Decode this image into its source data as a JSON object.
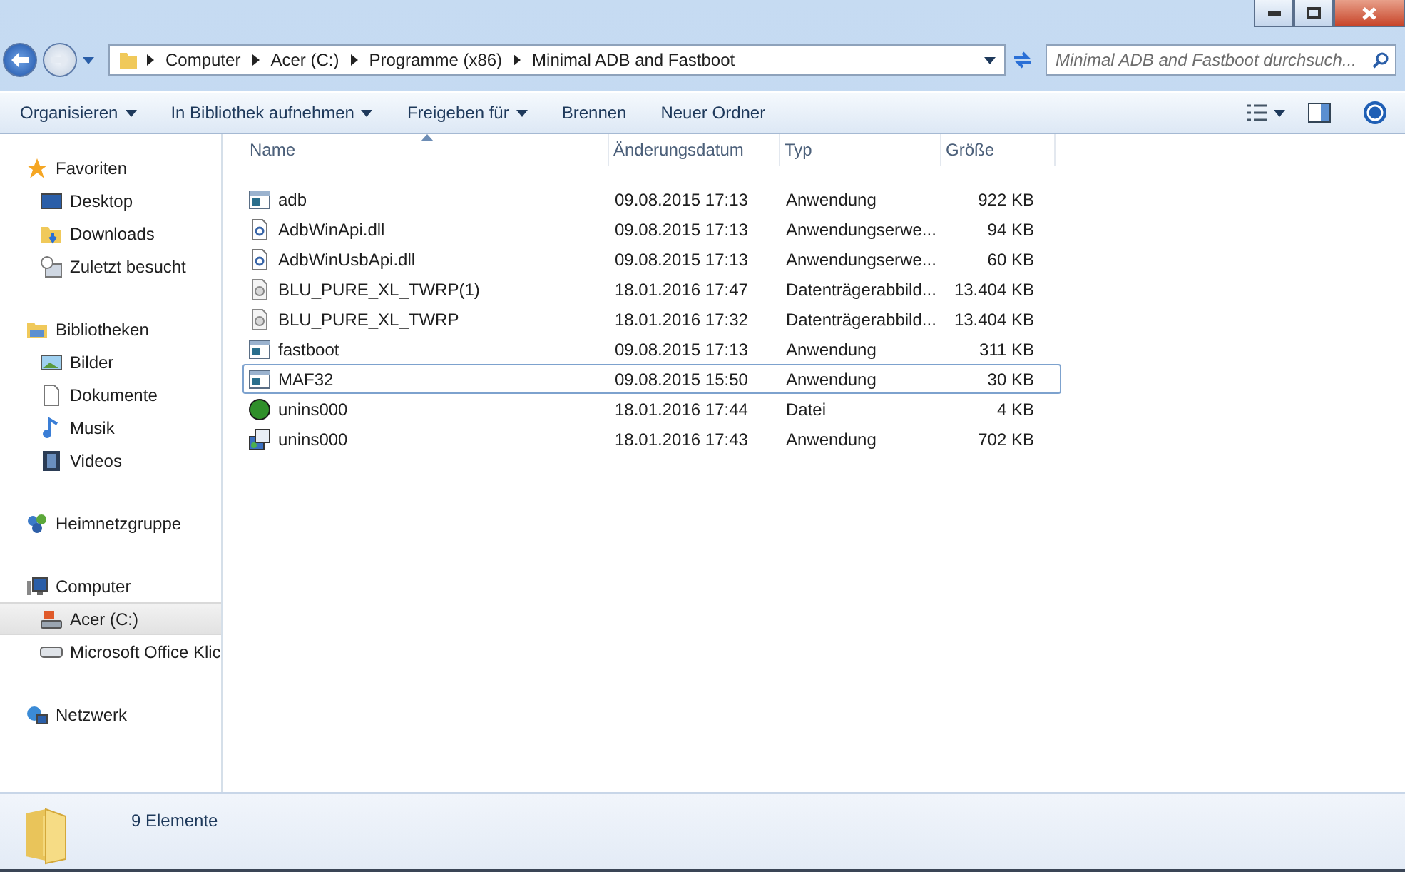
{
  "address": {
    "crumbs": [
      "Computer",
      "Acer (C:)",
      "Programme (x86)",
      "Minimal ADB and Fastboot"
    ]
  },
  "search": {
    "placeholder": "Minimal ADB and Fastboot durchsuch..."
  },
  "toolbar": {
    "items": [
      {
        "label": "Organisieren",
        "dropdown": true
      },
      {
        "label": "In Bibliothek aufnehmen",
        "dropdown": true
      },
      {
        "label": "Freigeben für",
        "dropdown": true
      },
      {
        "label": "Brennen",
        "dropdown": false
      },
      {
        "label": "Neuer Ordner",
        "dropdown": false
      }
    ]
  },
  "sidebar": {
    "groups": [
      {
        "label": "Favoriten",
        "kind": "star",
        "selected": false,
        "children": [
          {
            "label": "Desktop",
            "kind": "desktop",
            "selected": false
          },
          {
            "label": "Downloads",
            "kind": "download",
            "selected": false
          },
          {
            "label": "Zuletzt besucht",
            "kind": "recent",
            "selected": false
          }
        ]
      },
      {
        "label": "Bibliotheken",
        "kind": "library",
        "selected": false,
        "children": [
          {
            "label": "Bilder",
            "kind": "image",
            "selected": false
          },
          {
            "label": "Dokumente",
            "kind": "document",
            "selected": false
          },
          {
            "label": "Musik",
            "kind": "music",
            "selected": false
          },
          {
            "label": "Videos",
            "kind": "video",
            "selected": false
          }
        ]
      },
      {
        "label": "Heimnetzgruppe",
        "kind": "homegroup",
        "selected": false
      },
      {
        "label": "Computer",
        "kind": "computer",
        "selected": false,
        "children": [
          {
            "label": "Acer (C:)",
            "kind": "drive",
            "selected": true
          },
          {
            "label": "Microsoft Office Klic",
            "kind": "disk",
            "selected": false
          }
        ]
      },
      {
        "label": "Netzwerk",
        "kind": "network",
        "selected": false
      }
    ]
  },
  "table": {
    "columns": [
      {
        "label": "Name",
        "sorted": true
      },
      {
        "label": "Änderungsdatum",
        "sorted": false
      },
      {
        "label": "Typ",
        "sorted": false
      },
      {
        "label": "Größe",
        "sorted": false
      }
    ],
    "rows": [
      {
        "name": "adb",
        "date": "09.08.2015 17:13",
        "type": "Anwendung",
        "size": "922 KB",
        "kind": "app",
        "focused": false
      },
      {
        "name": "AdbWinApi.dll",
        "date": "09.08.2015 17:13",
        "type": "Anwendungserwe...",
        "size": "94 KB",
        "kind": "dll",
        "focused": false
      },
      {
        "name": "AdbWinUsbApi.dll",
        "date": "09.08.2015 17:13",
        "type": "Anwendungserwe...",
        "size": "60 KB",
        "kind": "dll",
        "focused": false
      },
      {
        "name": "BLU_PURE_XL_TWRP(1)",
        "date": "18.01.2016 17:47",
        "type": "Datenträgerabbild...",
        "size": "13.404 KB",
        "kind": "image",
        "focused": false
      },
      {
        "name": "BLU_PURE_XL_TWRP",
        "date": "18.01.2016 17:32",
        "type": "Datenträgerabbild...",
        "size": "13.404 KB",
        "kind": "image",
        "focused": false
      },
      {
        "name": "fastboot",
        "date": "09.08.2015 17:13",
        "type": "Anwendung",
        "size": "311 KB",
        "kind": "app",
        "focused": false
      },
      {
        "name": "MAF32",
        "date": "09.08.2015 15:50",
        "type": "Anwendung",
        "size": "30 KB",
        "kind": "app",
        "focused": true
      },
      {
        "name": "unins000",
        "date": "18.01.2016 17:44",
        "type": "Datei",
        "size": "4 KB",
        "kind": "ball",
        "focused": false
      },
      {
        "name": "unins000",
        "date": "18.01.2016 17:43",
        "type": "Anwendung",
        "size": "702 KB",
        "kind": "installer",
        "focused": false
      }
    ]
  },
  "status_bar": {
    "text": "9 Elemente"
  }
}
